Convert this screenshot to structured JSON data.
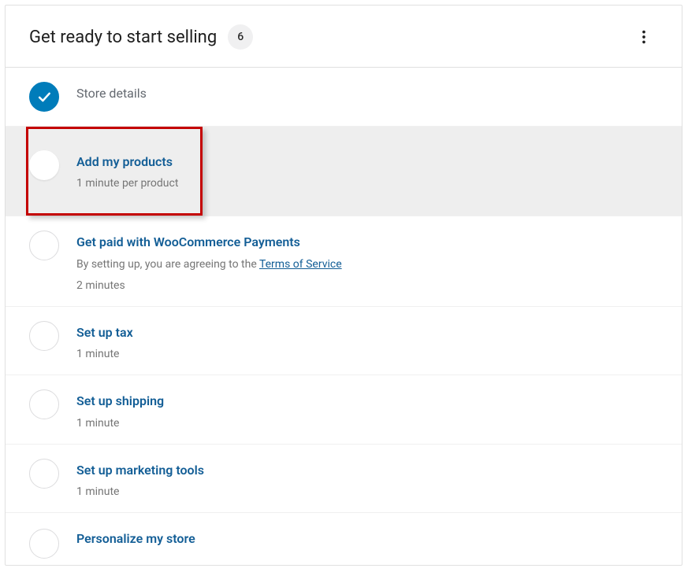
{
  "header": {
    "title": "Get ready to start selling",
    "badge": "6"
  },
  "tasks": [
    {
      "title": "Store details",
      "completed": true
    },
    {
      "title": "Add my products",
      "subtitle": "1 minute per product",
      "active": true,
      "highlighted": true
    },
    {
      "title": "Get paid with WooCommerce Payments",
      "subtitle_prefix": "By setting up, you are agreeing to the ",
      "subtitle_link": "Terms of Service",
      "time": "2 minutes"
    },
    {
      "title": "Set up tax",
      "time": "1 minute"
    },
    {
      "title": "Set up shipping",
      "time": "1 minute"
    },
    {
      "title": "Set up marketing tools",
      "time": "1 minute"
    },
    {
      "title": "Personalize my store"
    }
  ]
}
